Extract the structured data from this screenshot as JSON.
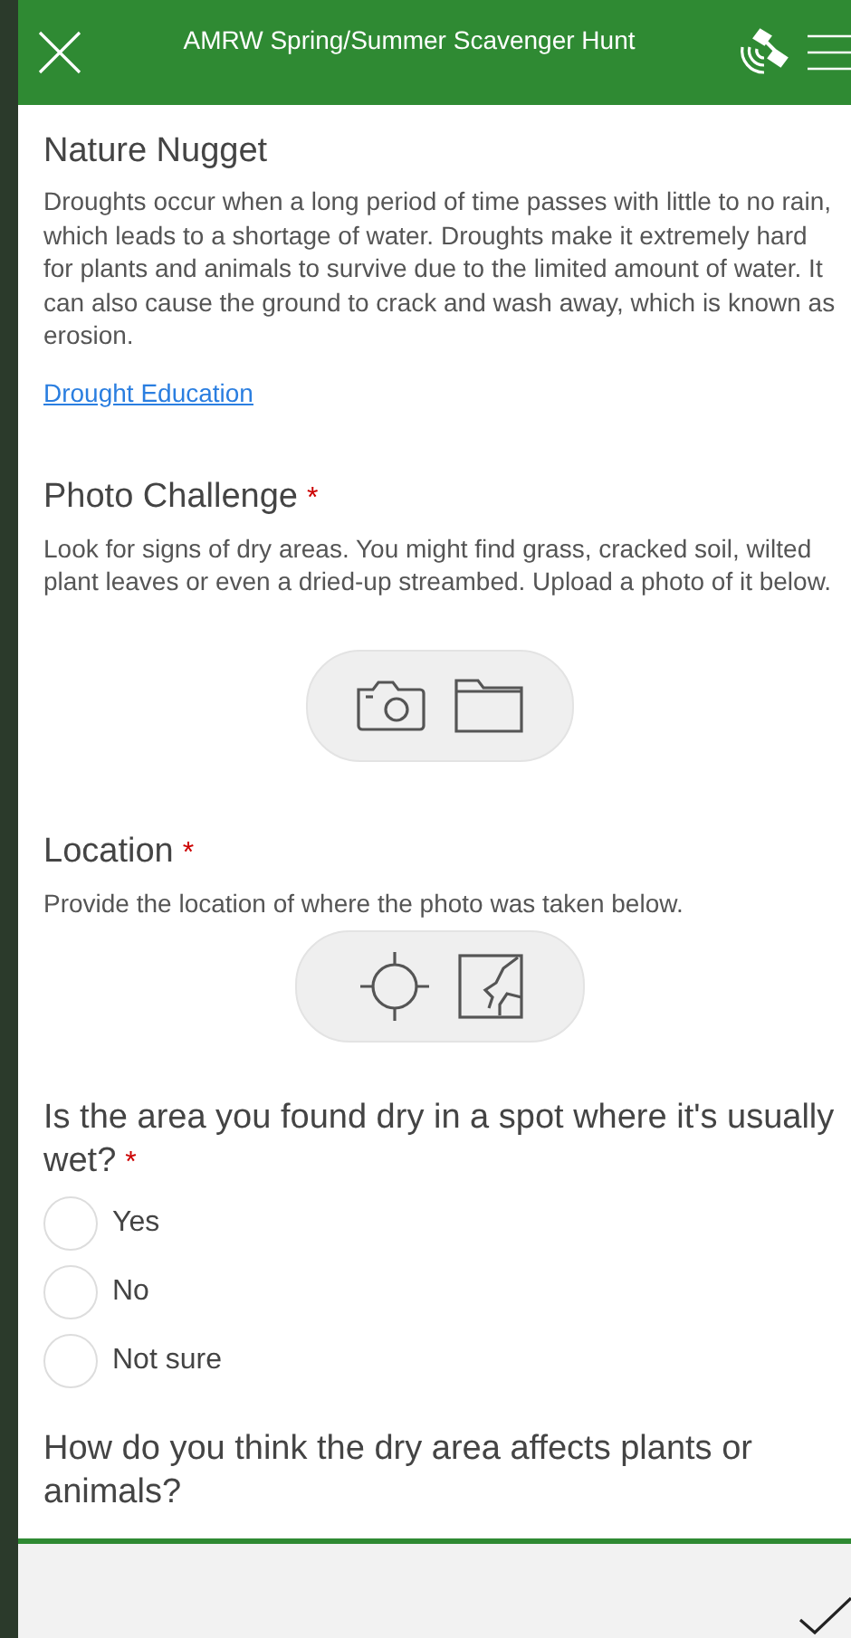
{
  "header": {
    "title": "AMRW Spring/Summer Scavenger Hunt"
  },
  "note": {
    "title": "Nature Nugget",
    "text": "Droughts occur when a long period of time passes with little to no rain, which leads to a shortage of water. Droughts make it extremely hard for plants and animals to survive due to the limited amount of water. It can also cause the ground to crack and wash away, which is known as erosion.",
    "link": "Drought Education"
  },
  "questions": [
    {
      "kind": "photo",
      "label": "Photo Challenge",
      "required_mark": "*",
      "hint": "Look for signs of dry areas. You might find grass, cracked soil, wilted plant leaves or even a dried-up streambed. Upload a photo of it below."
    },
    {
      "kind": "location",
      "label": "Location",
      "required_mark": "*",
      "hint": "Provide the location of where the photo was taken below."
    },
    {
      "kind": "choice",
      "label": "Is the area you found dry in a spot where it's usually wet?",
      "required_mark": "*",
      "options": [
        {
          "label": "Yes",
          "selected": false
        },
        {
          "label": "No",
          "selected": false
        },
        {
          "label": "Not sure",
          "selected": false
        }
      ]
    },
    {
      "kind": "text",
      "label": "How do you think the dry area affects plants or animals?"
    }
  ]
}
